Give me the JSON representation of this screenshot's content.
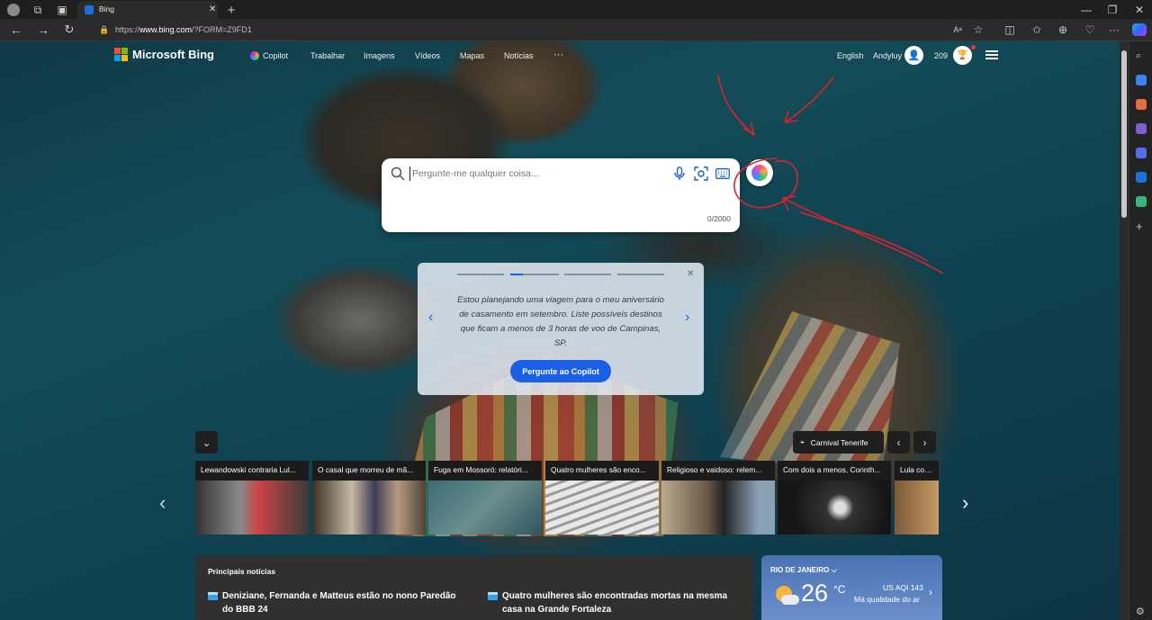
{
  "browser": {
    "tab_title": "Bing",
    "url_host": "www.bing.com",
    "url_path": "/?FORM=Z9FD1",
    "url_scheme": "https://"
  },
  "header": {
    "brand": "Microsoft Bing",
    "nav": [
      "Copilot",
      "Trabalhar",
      "Imagens",
      "Vídeos",
      "Mapas",
      "Notícias",
      "···"
    ],
    "language": "English",
    "username": "Andyluy",
    "points": "209"
  },
  "search": {
    "placeholder": "Pergunte-me qualquer coisa...",
    "counter": "0/2000"
  },
  "suggestion": {
    "text": "Estou planejando uma viagem para o meu aniversário de casamento em setembro. Liste possíveis destinos que ficam a menos de 3 horas de voo de Campinas, SP.",
    "button": "Pergunte ao Copilot"
  },
  "location": "Carnival Tenerife",
  "news": [
    {
      "caption": "Lewandowski contraria Lul...",
      "color": "#6a6a6a"
    },
    {
      "caption": "O casal que morreu de mã...",
      "color": "#4d4337"
    },
    {
      "caption": "Fuga em Mossoró: relatóri...",
      "color": "#3d6b78"
    },
    {
      "caption": "Quatro mulheres são enco...",
      "color": "#d8d8d8"
    },
    {
      "caption": "Religioso e vaidoso: relem...",
      "color": "#7a6a58"
    },
    {
      "caption": "Com dois a menos, Corinth...",
      "color": "#2a2a2a"
    },
    {
      "caption": "Lula compa",
      "color": "#7a5a3a"
    }
  ],
  "top_news": {
    "heading": "Principais notícias",
    "items": [
      {
        "title": "Deniziane, Fernanda e Matteus estão no nono Paredão do BBB 24"
      },
      {
        "title": "Quatro mulheres são encontradas mortas na mesma casa na Grande Fortaleza"
      }
    ]
  },
  "weather": {
    "city": "RIO DE JANEIRO",
    "temp": "26",
    "unit": "°C",
    "aqi": "US AQI 143",
    "quality": "Má qualidade do ar"
  }
}
